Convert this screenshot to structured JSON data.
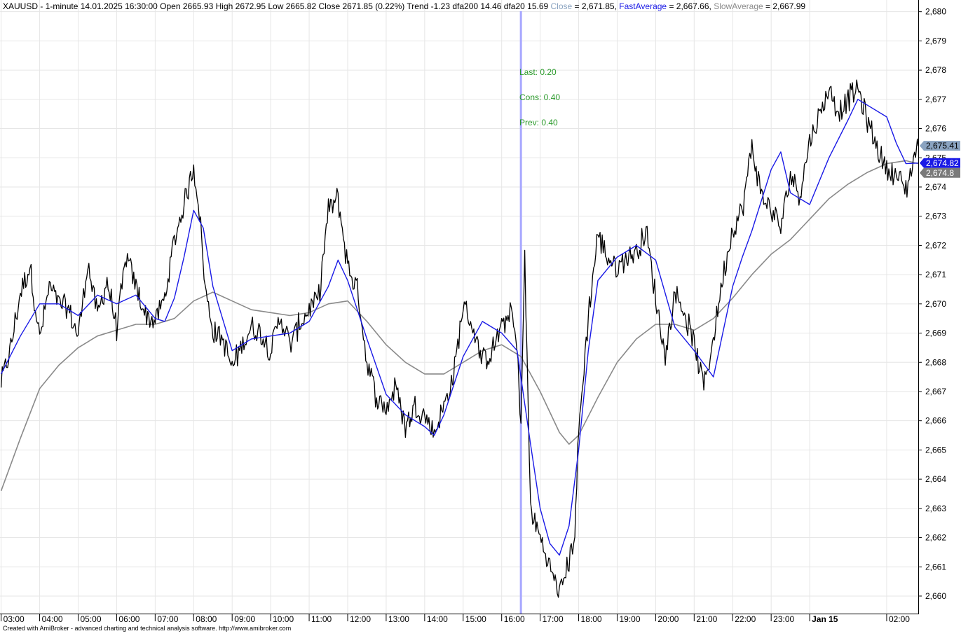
{
  "header": {
    "symbol": "XAUUSD",
    "interval": "1-minute",
    "datetime": "14.01.2025 16:30:00",
    "open_label": "Open",
    "open": "2665.93",
    "high_label": "High",
    "high": "2672.95",
    "low_label": "Low",
    "low": "2665.82",
    "close_label": "Close",
    "close": "2671.85",
    "change": "(0.22%)",
    "trend_label": "Trend",
    "trend": "-1.23",
    "dfa200_label": "dfa200",
    "dfa200": "14.46",
    "dfa20_label": "dfa20",
    "dfa20": "15.69",
    "indicators": [
      {
        "name": "Close",
        "value": "= 2,671.85",
        "color": "#8aa3c0"
      },
      {
        "name": "FastAverage",
        "value": "= 2,667.66",
        "color": "#1a1ae6"
      },
      {
        "name": "SlowAverage",
        "value": "= 2,667.99",
        "color": "#8a8a8a"
      }
    ]
  },
  "annotations": {
    "last": "Last: 0.20",
    "cons": "Cons: 0.40",
    "prev": "Prev: 0.40",
    "color": "#2a9a2a"
  },
  "price_badges": {
    "close": {
      "label": "2,675.41",
      "value": 2675.41,
      "bg": "#8aa3c0"
    },
    "fast": {
      "label": "2,674.82",
      "value": 2674.82,
      "bg": "#1a1ae6"
    },
    "slow": {
      "label": "2,674.8",
      "value": 2674.8,
      "bg": "#7a7a7a"
    }
  },
  "footer": {
    "credit": "Created with AmiBroker - advanced charting and technical analysis software. http://www.amibroker.com"
  },
  "colors": {
    "price": "#000000",
    "fast": "#1a1ae6",
    "slow": "#8a8a8a",
    "grid": "#e6e6e6",
    "cursor": "#a8a8ff"
  },
  "chart_data": {
    "type": "line",
    "ylim": [
      2659.4,
      2680.4
    ],
    "y_ticks": [
      2660,
      2661,
      2662,
      2663,
      2664,
      2665,
      2666,
      2667,
      2668,
      2669,
      2670,
      2671,
      2672,
      2673,
      2674,
      2675,
      2676,
      2677,
      2678,
      2679,
      2680
    ],
    "y_tick_labels": [
      "2,660",
      "2,661",
      "2,662",
      "2,663",
      "2,664",
      "2,665",
      "2,666",
      "2,667",
      "2,668",
      "2,669",
      "2,670",
      "2,671",
      "2,672",
      "2,673",
      "2,674",
      "2,675",
      "2,676",
      "2,677",
      "2,678",
      "2,679",
      "2,680"
    ],
    "x_unit": "hour",
    "x_range": [
      2.97,
      26.82
    ],
    "x_tick_labels": [
      "03:00",
      "04:00",
      "05:00",
      "06:00",
      "07:00",
      "08:00",
      "09:00",
      "10:00",
      "11:00",
      "12:00",
      "13:00",
      "14:00",
      "15:00",
      "16:00",
      "17:00",
      "18:00",
      "19:00",
      "20:00",
      "21:00",
      "22:00",
      "23:00",
      "Jan 15",
      "02:00"
    ],
    "x_tick_hours": [
      3,
      4,
      5,
      6,
      7,
      8,
      9,
      10,
      11,
      12,
      13,
      14,
      15,
      16,
      17,
      18,
      19,
      20,
      21,
      22,
      23,
      24,
      26
    ],
    "cursor_hour": 16.5,
    "series": [
      {
        "name": "Close",
        "x": [
          3.0,
          3.25,
          3.5,
          3.75,
          4.0,
          4.25,
          4.5,
          4.75,
          5.0,
          5.25,
          5.5,
          5.75,
          6.0,
          6.25,
          6.5,
          6.75,
          7.0,
          7.25,
          7.5,
          7.75,
          8.0,
          8.15,
          8.3,
          8.5,
          8.75,
          9.0,
          9.25,
          9.5,
          9.75,
          10.0,
          10.25,
          10.5,
          10.75,
          11.0,
          11.25,
          11.5,
          11.75,
          12.0,
          12.25,
          12.35,
          12.5,
          12.75,
          13.0,
          13.25,
          13.5,
          13.75,
          14.0,
          14.25,
          14.5,
          14.75,
          15.0,
          15.25,
          15.5,
          15.75,
          16.0,
          16.25,
          16.4,
          16.5,
          16.6,
          16.75,
          17.0,
          17.25,
          17.5,
          17.75,
          17.9,
          18.0,
          18.25,
          18.5,
          18.75,
          19.0,
          19.25,
          19.5,
          19.75,
          20.0,
          20.25,
          20.5,
          20.75,
          21.0,
          21.25,
          21.5,
          21.75,
          22.0,
          22.25,
          22.5,
          22.75,
          23.0,
          23.25,
          23.5,
          23.75,
          24.0,
          24.25,
          24.5,
          24.75,
          25.0,
          25.25,
          25.5,
          25.75,
          26.0,
          26.25,
          26.5,
          26.75,
          26.82
        ],
        "values": [
          2667.3,
          2668.5,
          2670.4,
          2671.3,
          2668.8,
          2670.6,
          2670.0,
          2669.8,
          2668.9,
          2671.4,
          2669.6,
          2670.8,
          2669.2,
          2671.6,
          2670.6,
          2669.6,
          2669.4,
          2670.2,
          2672.2,
          2673.4,
          2674.7,
          2673.2,
          2670.5,
          2669.1,
          2668.8,
          2667.8,
          2668.6,
          2669.2,
          2669.0,
          2668.4,
          2669.6,
          2668.6,
          2669.3,
          2669.8,
          2670.2,
          2673.2,
          2673.6,
          2671.3,
          2670.5,
          2669.6,
          2668.0,
          2666.8,
          2666.4,
          2667.2,
          2665.8,
          2666.5,
          2666.2,
          2665.6,
          2666.5,
          2667.5,
          2670.0,
          2669.2,
          2668.0,
          2668.4,
          2669.2,
          2669.8,
          2668.4,
          2666.0,
          2671.5,
          2663.0,
          2662.0,
          2661.0,
          2660.1,
          2661.2,
          2662.2,
          2665.6,
          2669.6,
          2672.4,
          2671.6,
          2671.2,
          2671.6,
          2671.8,
          2672.5,
          2670.2,
          2668.2,
          2670.4,
          2669.7,
          2668.6,
          2667.2,
          2668.8,
          2671.0,
          2672.6,
          2673.2,
          2675.4,
          2673.7,
          2673.2,
          2672.6,
          2674.4,
          2673.8,
          2675.6,
          2676.4,
          2677.4,
          2676.6,
          2677.0,
          2677.4,
          2676.2,
          2675.4,
          2674.6,
          2674.4,
          2673.9,
          2675.2,
          2675.41
        ]
      },
      {
        "name": "FastAverage",
        "x": [
          3.0,
          3.5,
          4.0,
          4.5,
          5.0,
          5.5,
          6.0,
          6.5,
          7.0,
          7.25,
          7.5,
          7.75,
          8.0,
          8.25,
          8.5,
          9.0,
          9.5,
          10.0,
          10.5,
          11.0,
          11.5,
          11.75,
          12.0,
          12.5,
          13.0,
          13.5,
          14.0,
          14.25,
          14.5,
          15.0,
          15.5,
          16.0,
          16.4,
          16.75,
          17.0,
          17.25,
          17.5,
          17.75,
          18.0,
          18.25,
          18.5,
          19.0,
          19.5,
          20.0,
          20.5,
          21.0,
          21.5,
          22.0,
          22.25,
          22.5,
          23.0,
          23.25,
          23.5,
          24.0,
          24.5,
          25.0,
          25.25,
          25.5,
          26.0,
          26.25,
          26.5,
          26.82
        ],
        "values": [
          2667.6,
          2668.9,
          2670.0,
          2670.0,
          2669.6,
          2670.3,
          2670.0,
          2670.3,
          2669.5,
          2669.4,
          2670.2,
          2671.6,
          2673.2,
          2672.6,
          2670.6,
          2668.4,
          2668.8,
          2668.9,
          2669.0,
          2669.4,
          2670.6,
          2671.5,
          2670.8,
          2668.8,
          2666.9,
          2666.2,
          2665.8,
          2665.5,
          2666.2,
          2668.2,
          2669.4,
          2669.0,
          2668.4,
          2665.2,
          2663.0,
          2661.8,
          2661.4,
          2662.4,
          2665.0,
          2668.4,
          2670.8,
          2671.6,
          2672.0,
          2671.5,
          2669.2,
          2668.4,
          2667.5,
          2670.6,
          2671.6,
          2672.5,
          2674.6,
          2675.2,
          2673.8,
          2673.4,
          2675.0,
          2676.3,
          2677.0,
          2676.8,
          2676.4,
          2675.5,
          2674.8,
          2674.82
        ]
      },
      {
        "name": "SlowAverage",
        "x": [
          3.0,
          3.5,
          4.0,
          4.5,
          5.0,
          5.5,
          6.0,
          6.5,
          7.0,
          7.5,
          8.0,
          8.5,
          9.0,
          9.5,
          10.0,
          10.5,
          11.0,
          11.5,
          12.0,
          12.5,
          13.0,
          13.5,
          14.0,
          14.5,
          15.0,
          15.5,
          16.0,
          16.5,
          17.0,
          17.5,
          17.75,
          18.0,
          18.5,
          19.0,
          19.5,
          20.0,
          20.5,
          21.0,
          21.5,
          22.0,
          22.5,
          23.0,
          23.5,
          24.0,
          24.5,
          25.0,
          25.5,
          26.0,
          26.5,
          26.82
        ],
        "values": [
          2663.6,
          2665.4,
          2667.1,
          2667.9,
          2668.5,
          2668.9,
          2669.1,
          2669.3,
          2669.3,
          2669.5,
          2670.1,
          2670.4,
          2670.1,
          2669.8,
          2669.7,
          2669.6,
          2669.7,
          2670.0,
          2670.1,
          2669.4,
          2668.6,
          2668.0,
          2667.6,
          2667.6,
          2668.0,
          2668.4,
          2668.6,
          2668.2,
          2667.0,
          2665.6,
          2665.2,
          2665.5,
          2666.8,
          2668.0,
          2668.8,
          2669.3,
          2669.3,
          2669.1,
          2669.5,
          2670.2,
          2671.0,
          2671.7,
          2672.2,
          2672.9,
          2673.6,
          2674.1,
          2674.5,
          2674.8,
          2674.9,
          2674.8
        ]
      }
    ]
  }
}
